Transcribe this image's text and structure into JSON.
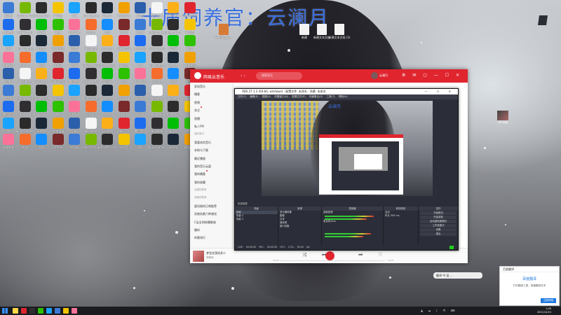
{
  "wallpaper": {
    "overlay_title": "十届饲养官：云澜月"
  },
  "desktop_icons": [
    {
      "label": "浏览器",
      "color": "#3b7bd6"
    },
    {
      "label": "GeForce Experience",
      "color": "#76b900"
    },
    {
      "label": "Ubisoft Connect",
      "color": "#2c2c2c"
    },
    {
      "label": "YY语音",
      "color": "#f5c400"
    },
    {
      "label": "QQ",
      "color": "#1aa3ff"
    },
    {
      "label": "Epic Games",
      "color": "#2a2a2a"
    },
    {
      "label": "Steam",
      "color": "#1b2838"
    },
    {
      "label": "UU加速器",
      "color": "#f0a000"
    },
    {
      "label": "Uplay",
      "color": "#2c5fab"
    },
    {
      "label": "WeGame",
      "color": "#f5f5f5"
    },
    {
      "label": "Rockstar",
      "color": "#fcaf17"
    },
    {
      "label": "网易云音乐",
      "color": "#e0252f"
    },
    {
      "label": "腾讯会议",
      "color": "#1d6cf0"
    },
    {
      "label": "OBS Studio",
      "color": "#302e31"
    },
    {
      "label": "爱奇艺",
      "color": "#00be06"
    },
    {
      "label": "微信",
      "color": "#2dc100"
    },
    {
      "label": "哔哩哔哩",
      "color": "#fb7299"
    },
    {
      "label": "Origin",
      "color": "#f56c2d"
    },
    {
      "label": "战网",
      "color": "#148eff"
    },
    {
      "label": "CPUID",
      "color": "#7a2a2a"
    }
  ],
  "top_files": [
    {
      "label": "Hellblog_9..."
    },
    {
      "label": "新建"
    },
    {
      "label": "新建文本文档"
    },
    {
      "label": "新建文本文档 (2)"
    }
  ],
  "netease": {
    "app_name": "网易云音乐",
    "search_placeholder": "搜索音乐",
    "username": "云澜月",
    "sidebar": [
      {
        "label": "发现音乐",
        "section": false
      },
      {
        "label": "播客",
        "section": false
      },
      {
        "label": "视频",
        "section": false
      },
      {
        "label": "关注",
        "section": false,
        "dot": true
      },
      {
        "label": "直播",
        "section": false
      },
      {
        "label": "私人FM",
        "section": false
      },
      {
        "label": "我的音乐",
        "section": true
      },
      {
        "label": "我喜欢的音乐",
        "section": false
      },
      {
        "label": "本地与下载",
        "section": false
      },
      {
        "label": "最近播放",
        "section": false
      },
      {
        "label": "我的音乐云盘",
        "section": false
      },
      {
        "label": "我的播客",
        "section": false,
        "dot": true
      },
      {
        "label": "我的收藏",
        "section": false
      },
      {
        "label": "创建的歌单",
        "section": true
      },
      {
        "label": "收藏的歌单",
        "section": true
      },
      {
        "label": "超风格的日常推荐",
        "section": false
      },
      {
        "label": "深夜失眠六种感觉",
        "section": false
      },
      {
        "label": "C宝全网热播歌曲",
        "section": false
      },
      {
        "label": "慢听",
        "section": false
      },
      {
        "label": "听歌排行",
        "section": false
      }
    ],
    "player": {
      "song": "梦里花落知多少",
      "artist": "郭敬明",
      "elapsed": "00:00",
      "duration": "04:21"
    }
  },
  "obs": {
    "title": "OBS 27.1.3 (64-bit, windows) - 配置文件: 未命名 - 场景: 未命名",
    "menu": [
      "文件(F)",
      "编辑(E)",
      "视图(V)",
      "停靠窗口(D)",
      "配置文件(P)",
      "场景集合(S)",
      "工具(T)",
      "帮助(H)"
    ],
    "preview_label": "云澜月",
    "docks": {
      "scenes_title": "场景",
      "scenes": [
        "场景",
        "场景 2",
        "场景 3"
      ],
      "sources_title": "来源",
      "sources": [
        "显示器采集",
        "图像",
        "文本",
        "媒体源",
        "窗口采集"
      ],
      "mixer_title": "混音器",
      "mixer": [
        "桌面音频",
        "麦克风/Aux"
      ],
      "transitions_title": "转场特效",
      "transitions": [
        "淡出",
        "时长",
        "300 ms"
      ],
      "controls_title": "控件",
      "controls": [
        "开始推流",
        "开始录制",
        "启动虚拟摄像机",
        "工作室模式",
        "设置",
        "退出"
      ]
    },
    "status": "LIVE: 00:00:00  REC: 00:00:00  CPU: 2.5%, 60.00 fps",
    "current_scene_label": "未选择源"
  },
  "notification": {
    "app": "百度翻译",
    "title": "百度翻译",
    "body": "打开翻译工具，快速翻译文本",
    "button": "立即体验"
  },
  "right_desktop_icon": "GIF动画",
  "tray_pill": "翻译 中 英 …",
  "taskbar": {
    "time": "1:09",
    "date": "2021/12/24"
  }
}
